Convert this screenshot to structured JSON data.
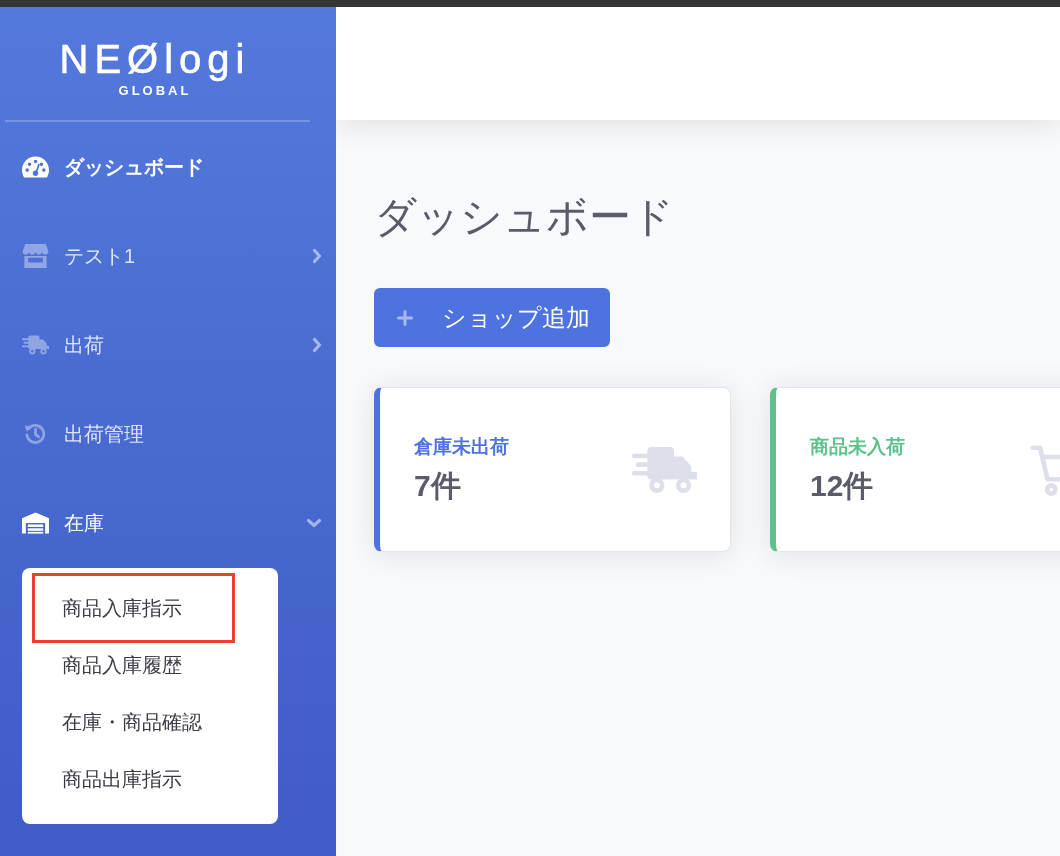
{
  "sidebar": {
    "logo": {
      "title": "NEØlogi",
      "subtitle": "GLOBAL"
    },
    "items": [
      {
        "label": "ダッシュボード",
        "kind": "link",
        "selected": true
      },
      {
        "label": "テスト1",
        "kind": "group",
        "selected": false,
        "expanded": false
      },
      {
        "label": "出荷",
        "kind": "group",
        "selected": false,
        "expanded": false
      },
      {
        "label": "出荷管理",
        "kind": "link",
        "selected": false
      },
      {
        "label": "在庫",
        "kind": "group",
        "selected": false,
        "expanded": true,
        "children": [
          {
            "label": "商品入庫指示",
            "highlighted": true
          },
          {
            "label": "商品入庫履歴",
            "highlighted": false
          },
          {
            "label": "在庫・商品確認",
            "highlighted": false
          },
          {
            "label": "商品出庫指示",
            "highlighted": false
          }
        ]
      }
    ]
  },
  "page": {
    "title": "ダッシュボード",
    "add_button": "ショップ追加",
    "cards": [
      {
        "label": "倉庫未出荷",
        "value": "7件",
        "color": "#4e73df"
      },
      {
        "label": "商品未入荷",
        "value": "12件",
        "color": "#5cc28c"
      }
    ]
  }
}
